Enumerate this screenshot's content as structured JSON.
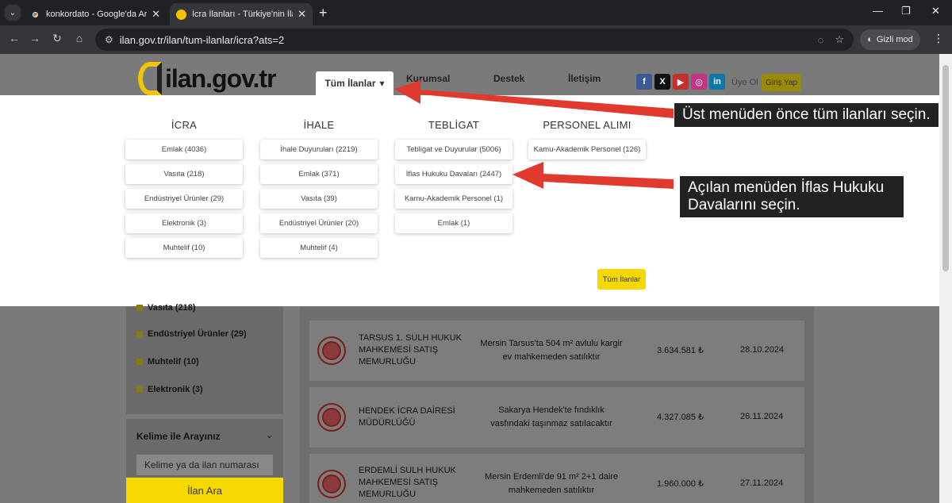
{
  "browser": {
    "tabs": [
      {
        "title": "konkordato - Google'da Ara"
      },
      {
        "title": "İcra İlanları - Türkiye'nin İlan Po"
      }
    ],
    "url": "ilan.gov.tr/ilan/tum-ilanlar/icra?ats=2",
    "incognito_label": "Gizli mod"
  },
  "header": {
    "logo_text": "ilan.gov.tr",
    "tum_ilanlar": "Tüm İlanlar",
    "nav": [
      "Kurumsal",
      "Destek",
      "İletişim"
    ],
    "uye_ol": "Üye Ol",
    "giris_yap": "Giriş Yap",
    "social": [
      {
        "icon": "facebook-icon",
        "glyph": "f",
        "color": "#3b5998"
      },
      {
        "icon": "x-icon",
        "glyph": "X",
        "color": "#111111"
      },
      {
        "icon": "youtube-icon",
        "glyph": "▶",
        "color": "#c4302b"
      },
      {
        "icon": "instagram-icon",
        "glyph": "◎",
        "color": "#c13584"
      },
      {
        "icon": "linkedin-icon",
        "glyph": "in",
        "color": "#0e76a8"
      }
    ]
  },
  "mega_menu": {
    "columns": [
      {
        "title": "İCRA",
        "items": [
          "Emlak (4036)",
          "Vasıta (218)",
          "Endüstriyel Ürünler (29)",
          "Elektronik (3)",
          "Muhtelif (10)"
        ]
      },
      {
        "title": "İHALE",
        "items": [
          "İhale Duyuruları (2219)",
          "Emlak (371)",
          "Vasıta (39)",
          "Endüstriyel Ürünler (20)",
          "Muhtelif (4)"
        ]
      },
      {
        "title": "TEBLİGAT",
        "items": [
          "Tebligat ve Duyurular (5006)",
          "İflas Hukuku Davaları (2447)",
          "Kamu-Akademik Personel (1)",
          "Emlak (1)"
        ]
      },
      {
        "title": "PERSONEL ALIMI",
        "items": [
          "Kamu-Akademik Personel (126)"
        ]
      }
    ],
    "tum_ilanlar_button": "Tüm İlanlar"
  },
  "sidebar": {
    "categories": [
      "Vasıta (218)",
      "Endüstriyel Ürünler (29)",
      "Muhtelif (10)",
      "Elektronik (3)"
    ],
    "kelime_title": "Kelime ile Arayınız",
    "search_placeholder": "Kelime ya da ilan numarası",
    "search_button": "İlan Ara"
  },
  "listings": [
    {
      "court": "TARSUS 1. SULH HUKUK MAHKEMESİ SATIŞ MEMURLUĞU",
      "desc": "Mersin Tarsus'ta 504 m² avlulu kargir ev mahkemeden satılıktır",
      "price": "3.634.581 ₺",
      "date": "28.10.2024"
    },
    {
      "court": "HENDEK İCRA DAİRESİ MÜDÜRLÜĞÜ",
      "desc": "Sakarya Hendek'te fındıklık vasfındaki taşınmaz satılacaktır",
      "price": "4.327.085 ₺",
      "date": "26.11.2024"
    },
    {
      "court": "ERDEMLİ SULH HUKUK MAHKEMESİ SATIŞ MEMURLUĞU",
      "desc": "Mersin Erdemli'de 91 m² 2+1 daire mahkemeden satılıktır",
      "price": "1.960.000 ₺",
      "date": "27.11.2024"
    }
  ],
  "annotations": {
    "callout1": "Üst menüden önce tüm ilanları seçin.",
    "callout2": "Açılan menüden İflas Hukuku Davalarını seçin.",
    "arrow_color": "#e03a2f"
  }
}
